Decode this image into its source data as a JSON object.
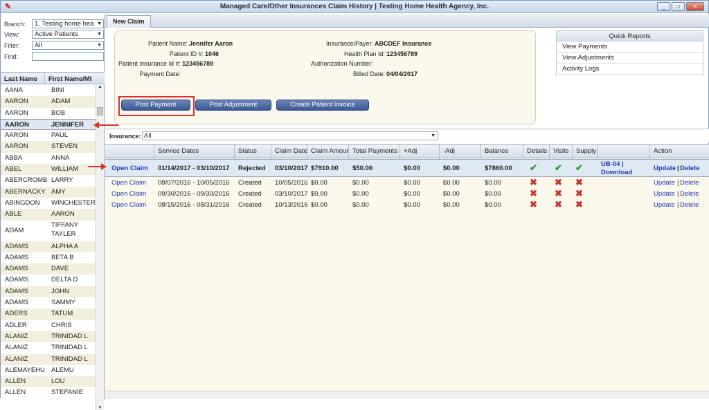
{
  "window": {
    "title": "Managed Care/Other Insurances Claim History | Testing Home Health Agency, Inc.",
    "min": "_",
    "max": "□",
    "close": "✕"
  },
  "filters": {
    "branch_label": "Branch:",
    "branch_value": "1. Testing home hea",
    "view_label": "View:",
    "view_value": "Active Patients",
    "filter_label": "Filter:",
    "filter_value": "All",
    "find_label": "Find:"
  },
  "patient_list": {
    "col_last": "Last Name",
    "col_first": "First Name/MI",
    "rows": [
      [
        "AANA",
        "BINI"
      ],
      [
        "AARON",
        "ADAM"
      ],
      [
        "AARON",
        "BOB"
      ],
      [
        "AARON",
        "JENNIFER"
      ],
      [
        "AARON",
        "PAUL"
      ],
      [
        "AARON",
        "STEVEN"
      ],
      [
        "ABBA",
        "ANNA"
      ],
      [
        "ABEL",
        "WILLIAM"
      ],
      [
        "ABERCROMBI",
        "LARRY"
      ],
      [
        "ABERNACKY",
        "AMY"
      ],
      [
        "ABINGDON",
        "WINCHESTER"
      ],
      [
        "ABLE",
        "AARON"
      ],
      [
        "ADAM",
        "TIFFANY TAYLER"
      ],
      [
        "ADAMS",
        "ALPHA A"
      ],
      [
        "ADAMS",
        "BETA B"
      ],
      [
        "ADAMS",
        "DAVE"
      ],
      [
        "ADAMS",
        "DELTA D"
      ],
      [
        "ADAMS",
        "JOHN"
      ],
      [
        "ADAMS",
        "SAMMY"
      ],
      [
        "ADERS",
        "TATUM"
      ],
      [
        "ADLER",
        "CHRIS"
      ],
      [
        "ALANIZ",
        "TRINIDAD L"
      ],
      [
        "ALANIZ",
        "TRINIDAD L"
      ],
      [
        "ALANIZ",
        "TRINIDAD L"
      ],
      [
        "ALEMAYEHU",
        "ALEMU"
      ],
      [
        "ALLEN",
        "LOU"
      ],
      [
        "ALLEN",
        "STEFANIE"
      ]
    ]
  },
  "tab": "New Claim",
  "info": {
    "patient_name_label": "Patient Name:",
    "patient_name": "Jennifer Aaron",
    "patient_id_label": "Patient ID #:",
    "patient_id": "1046",
    "ins_id_label": "Patient Insurance Id #:",
    "ins_id": "123456789",
    "payment_date_label": "Payment Date:",
    "payer_label": "Insurance/Payer:",
    "payer": "ABCDEF Insurance",
    "plan_label": "Health Plan Id:",
    "plan": "123456789",
    "auth_label": "Authorization Number:",
    "billed_label": "Billed Date:",
    "billed": "04/04/2017"
  },
  "buttons": {
    "post_payment": "Post Payment",
    "post_adjustment": "Post Adjustment",
    "create_invoice": "Create Patient Invoice"
  },
  "quick_reports": {
    "title": "Quick Reports",
    "items": [
      "View Payments",
      "View Adjustments",
      "Activity Logs"
    ]
  },
  "insurance": {
    "label": "Insurance:",
    "value": "All"
  },
  "claims": {
    "headers": [
      "",
      "Service Dates",
      "Status",
      "Claim Date",
      "Claim Amount",
      "Total Payments",
      "+Adj",
      "-Adj",
      "Balance",
      "Details",
      "Visits",
      "Supply",
      "",
      "Action"
    ],
    "rows": [
      {
        "open": "Open Claim",
        "dates": "01/14/2017 - 03/10/2017",
        "status": "Rejected",
        "cdate": "03/10/2017",
        "amount": "$7910.00",
        "payments": "$50.00",
        "padj": "$0.00",
        "nadj": "$0.00",
        "balance": "$7860.00",
        "details": "✔",
        "visits": "✔",
        "supply": "✔",
        "ub": "UB-04 |",
        "download": "Download",
        "update": "Update",
        "sep": "|",
        "delete": "Delete"
      },
      {
        "open": "Open Claim",
        "dates": "08/07/2016 - 10/05/2016",
        "status": "Created",
        "cdate": "10/05/2016",
        "amount": "$0.00",
        "payments": "$0.00",
        "padj": "$0.00",
        "nadj": "$0.00",
        "balance": "$0.00",
        "details": "✖",
        "visits": "✖",
        "supply": "✖",
        "ub": "",
        "download": "",
        "update": "Update",
        "sep": "|",
        "delete": "Delete"
      },
      {
        "open": "Open Claim",
        "dates": "09/30/2016 - 09/30/2016",
        "status": "Created",
        "cdate": "03/10/2017",
        "amount": "$0.00",
        "payments": "$0.00",
        "padj": "$0.00",
        "nadj": "$0.00",
        "balance": "$0.00",
        "details": "✖",
        "visits": "✖",
        "supply": "✖",
        "ub": "",
        "download": "",
        "update": "Update",
        "sep": "|",
        "delete": "Delete"
      },
      {
        "open": "Open Claim",
        "dates": "08/15/2016 - 08/31/2016",
        "status": "Created",
        "cdate": "10/13/2016",
        "amount": "$0.00",
        "payments": "$0.00",
        "padj": "$0.00",
        "nadj": "$0.00",
        "balance": "$0.00",
        "details": "✖",
        "visits": "✖",
        "supply": "✖",
        "ub": "",
        "download": "",
        "update": "Update",
        "sep": "|",
        "delete": "Delete"
      }
    ]
  },
  "colors": {
    "accent": "#3b5894",
    "highlight": "#d9342b",
    "ok": "#2a9a2a",
    "error": "#c8342e"
  }
}
